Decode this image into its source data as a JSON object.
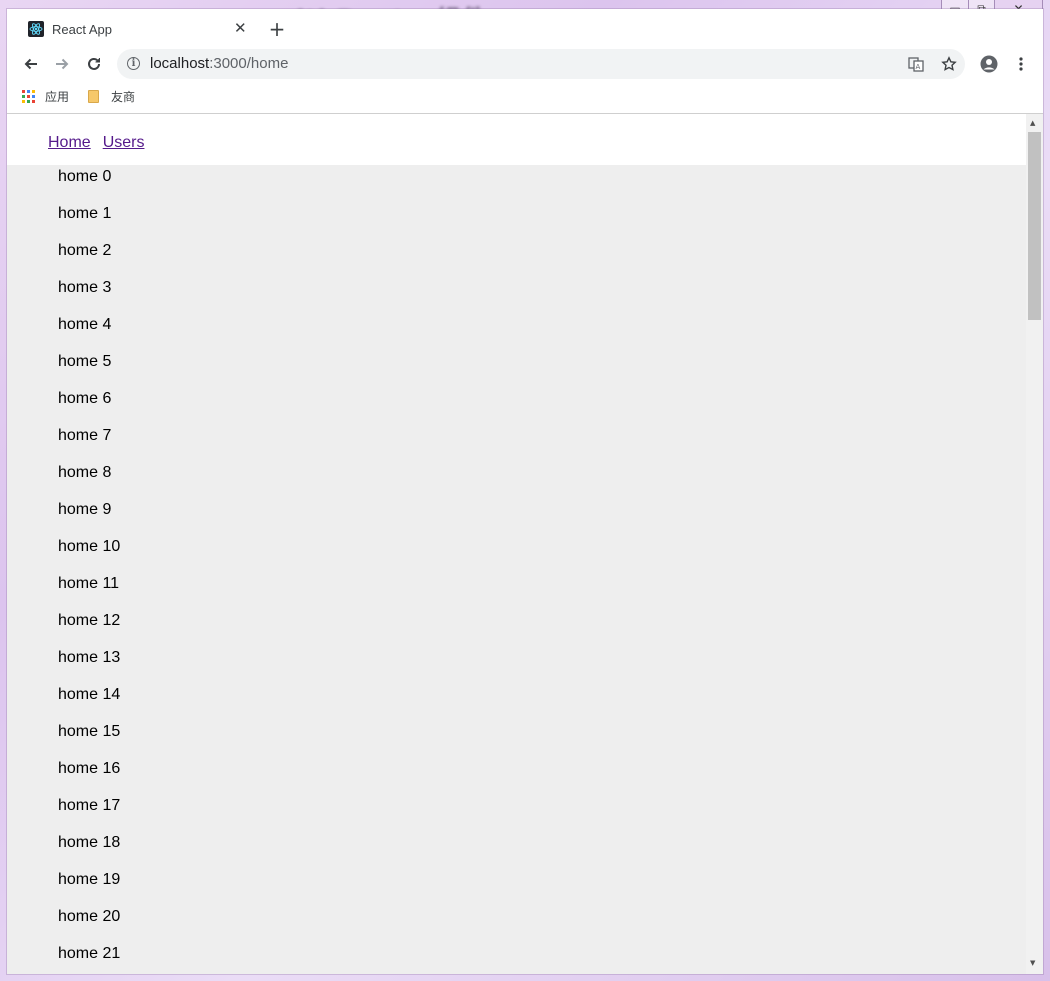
{
  "background_title": "withRouter组件",
  "tab": {
    "title": "React App",
    "close_glyph": "✕",
    "new_tab_glyph": "+"
  },
  "toolbar": {
    "url_host": "localhost",
    "url_rest": ":3000/home"
  },
  "bookmarks": [
    {
      "label": "应用",
      "icon": "apps-grid-icon"
    },
    {
      "label": "友商",
      "icon": "folder-icon"
    }
  ],
  "page": {
    "nav": [
      "Home",
      "Users"
    ],
    "items": [
      "home 0",
      "home 1",
      "home 2",
      "home 3",
      "home 4",
      "home 5",
      "home 6",
      "home 7",
      "home 8",
      "home 9",
      "home 10",
      "home 11",
      "home 12",
      "home 13",
      "home 14",
      "home 15",
      "home 16",
      "home 17",
      "home 18",
      "home 19",
      "home 20",
      "home 21"
    ]
  },
  "colors": {
    "link_visited": "#551a8b",
    "list_background": "#eeeeee",
    "desktop_tint": "#e2cdf0"
  }
}
